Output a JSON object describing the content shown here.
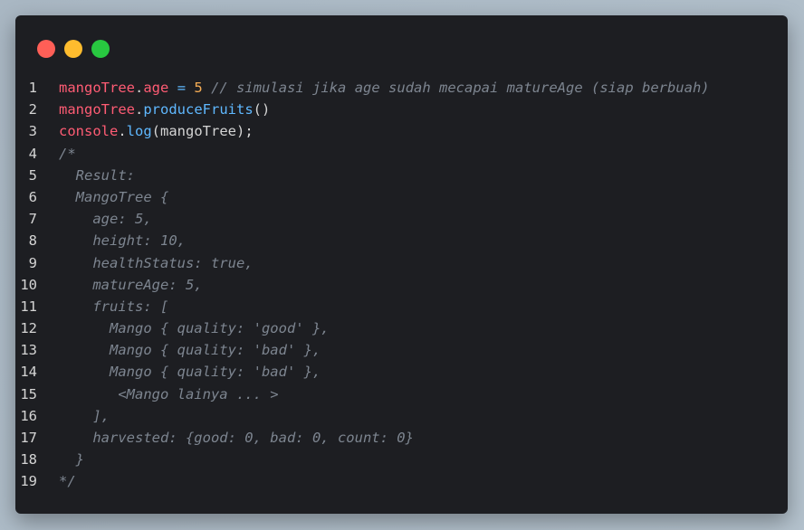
{
  "window": {
    "controls": {
      "close_color": "#ff5f57",
      "minimize_color": "#febc2e",
      "maximize_color": "#28c840"
    }
  },
  "lines": [
    {
      "num": "1",
      "tokens": [
        [
          "id",
          "mangoTree"
        ],
        [
          "punc",
          "."
        ],
        [
          "prop",
          "age"
        ],
        [
          "punc",
          " "
        ],
        [
          "op",
          "="
        ],
        [
          "punc",
          " "
        ],
        [
          "num",
          "5"
        ],
        [
          "punc",
          " "
        ],
        [
          "cmt",
          "// simulasi jika age sudah mecapai matureAge (siap berbuah)"
        ]
      ]
    },
    {
      "num": "2",
      "tokens": [
        [
          "id",
          "mangoTree"
        ],
        [
          "punc",
          "."
        ],
        [
          "fn",
          "produceFruits"
        ],
        [
          "punc",
          "()"
        ]
      ]
    },
    {
      "num": "3",
      "tokens": [
        [
          "id",
          "console"
        ],
        [
          "punc",
          "."
        ],
        [
          "fn",
          "log"
        ],
        [
          "punc",
          "(mangoTree);"
        ]
      ]
    },
    {
      "num": "4",
      "tokens": [
        [
          "cmt",
          "/*"
        ]
      ]
    },
    {
      "num": "5",
      "tokens": [
        [
          "cmt",
          "  Result:"
        ]
      ]
    },
    {
      "num": "6",
      "tokens": [
        [
          "cmt",
          "  MangoTree {"
        ]
      ]
    },
    {
      "num": "7",
      "tokens": [
        [
          "cmt",
          "    age: 5,"
        ]
      ]
    },
    {
      "num": "8",
      "tokens": [
        [
          "cmt",
          "    height: 10,"
        ]
      ]
    },
    {
      "num": "9",
      "tokens": [
        [
          "cmt",
          "    healthStatus: true,"
        ]
      ]
    },
    {
      "num": "10",
      "tokens": [
        [
          "cmt",
          "    matureAge: 5,"
        ]
      ]
    },
    {
      "num": "11",
      "tokens": [
        [
          "cmt",
          "    fruits: ["
        ]
      ]
    },
    {
      "num": "12",
      "tokens": [
        [
          "cmt",
          "      Mango { quality: 'good' },"
        ]
      ]
    },
    {
      "num": "13",
      "tokens": [
        [
          "cmt",
          "      Mango { quality: 'bad' },"
        ]
      ]
    },
    {
      "num": "14",
      "tokens": [
        [
          "cmt",
          "      Mango { quality: 'bad' },"
        ]
      ]
    },
    {
      "num": "15",
      "tokens": [
        [
          "cmt",
          "       <Mango lainya ... >"
        ]
      ]
    },
    {
      "num": "16",
      "tokens": [
        [
          "cmt",
          "    ],"
        ]
      ]
    },
    {
      "num": "17",
      "tokens": [
        [
          "cmt",
          "    harvested: {good: 0, bad: 0, count: 0}"
        ]
      ]
    },
    {
      "num": "18",
      "tokens": [
        [
          "cmt",
          "  }"
        ]
      ]
    },
    {
      "num": "19",
      "tokens": [
        [
          "cmt",
          "*/"
        ]
      ]
    }
  ]
}
